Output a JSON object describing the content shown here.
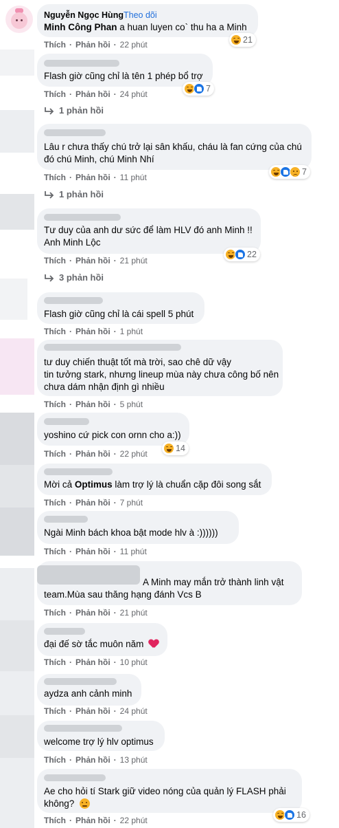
{
  "comments": [
    {
      "author": "Nguyễn Ngọc Hùng",
      "separator": "·",
      "follow": "Theo dõi",
      "mention": "Minh Công Phan",
      "text": "a huan luyen co` thu ha a Minh",
      "like": "Thích",
      "reply": "Phản hồi",
      "time": "22 phút",
      "reaction_count": "21",
      "reactions": [
        "haha"
      ]
    },
    {
      "lines": [
        "Flash giờ cũng chỉ là tên 1 phép bổ trợ"
      ],
      "like": "Thích",
      "reply": "Phản hồi",
      "time": "24 phút",
      "reaction_count": "7",
      "reactions": [
        "haha",
        "like"
      ],
      "replies_label": "1 phản hồi"
    },
    {
      "lines": [
        "Lâu r chưa thấy chú trở lại sân khấu, cháu là fan cứng của chú",
        "đó chú Minh, chú Minh Nhí"
      ],
      "like": "Thích",
      "reply": "Phản hồi",
      "time": "11 phút",
      "reaction_count": "7",
      "reactions": [
        "haha",
        "like",
        "sad"
      ],
      "replies_label": "1 phản hồi"
    },
    {
      "lines": [
        "Tư duy của anh dư sức để làm HLV đó anh Minh !!",
        "Anh Minh Lộc"
      ],
      "like": "Thích",
      "reply": "Phản hồi",
      "time": "21 phút",
      "reaction_count": "22",
      "reactions": [
        "haha",
        "like"
      ],
      "replies_label": "3 phản hồi"
    },
    {
      "lines": [
        "Flash giờ cũng chỉ là cái spell 5 phút"
      ],
      "like": "Thích",
      "reply": "Phản hồi",
      "time": "1 phút"
    },
    {
      "lines": [
        "tư duy chiến thuật tốt mà trời, sao chê dữ vậy",
        "tin tưởng stark, nhưng lineup mùa này chưa công bố nên",
        "chưa dám nhận định gì nhiều"
      ],
      "like": "Thích",
      "reply": "Phản hồi",
      "time": "5 phút"
    },
    {
      "lines": [
        "yoshino cứ pick con ornn cho a:))"
      ],
      "like": "Thích",
      "reply": "Phản hồi",
      "time": "22 phút",
      "reaction_count": "14",
      "reactions": [
        "haha"
      ]
    },
    {
      "prefix": "Mời cả",
      "mention": "Optimus",
      "suffix": "làm trợ lý là chuẩn cặp đôi song sắt",
      "like": "Thích",
      "reply": "Phản hồi",
      "time": "7 phút"
    },
    {
      "lines": [
        "Ngài Minh bách khoa bật mode hlv à :))))))"
      ],
      "like": "Thích",
      "reply": "Phản hồi",
      "time": "11 phút"
    },
    {
      "lines": [
        "A Minh may mắn trở thành linh vật",
        "team.Mùa sau thăng hạng đánh Vcs B"
      ],
      "like": "Thích",
      "reply": "Phản hồi",
      "time": "21 phút"
    },
    {
      "lines": [
        "đại đế sờ tắc muôn năm"
      ],
      "like": "Thích",
      "reply": "Phản hồi",
      "time": "10 phút"
    },
    {
      "lines": [
        "aydza anh cảnh minh"
      ],
      "like": "Thích",
      "reply": "Phản hồi",
      "time": "24 phút"
    },
    {
      "lines": [
        "welcome trợ lý hlv optimus"
      ],
      "like": "Thích",
      "reply": "Phản hồi",
      "time": "13 phút"
    },
    {
      "lines": [
        "Ae cho hỏi tí Stark giữ video nóng của quản lý FLASH phải",
        "không?"
      ],
      "like": "Thích",
      "reply": "Phản hồi",
      "time": "22 phút",
      "reaction_count": "16",
      "reactions": [
        "haha",
        "like"
      ]
    }
  ],
  "colors": {
    "bubble": "#f0f2f5",
    "link": "#216fdb",
    "meta": "#65676b",
    "text": "#050505"
  }
}
